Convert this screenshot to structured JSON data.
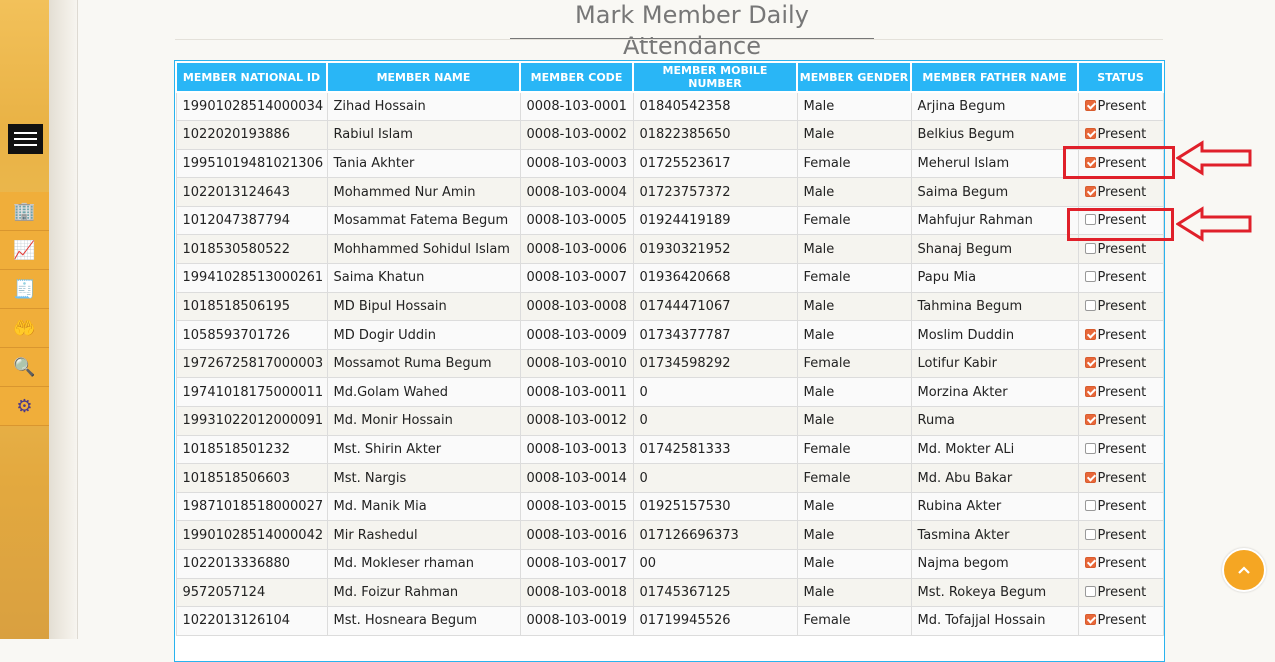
{
  "page": {
    "title": "Mark Member Daily Attendance"
  },
  "sidebar": {
    "menu_icon": "hamburger-icon",
    "items": [
      {
        "icon": "building-icon",
        "glyph": "🏢"
      },
      {
        "icon": "chart-up-icon",
        "glyph": "📈"
      },
      {
        "icon": "cash-register-icon",
        "glyph": "🧾"
      },
      {
        "icon": "hand-money-icon",
        "glyph": "🤲"
      },
      {
        "icon": "search-people-icon",
        "glyph": "🔍"
      },
      {
        "icon": "network-gear-icon",
        "glyph": "⚙"
      }
    ]
  },
  "table": {
    "columns": [
      "MEMBER NATIONAL ID",
      "MEMBER NAME",
      "MEMBER CODE",
      "MEMBER MOBILE NUMBER",
      "MEMBER GENDER",
      "MEMBER FATHER NAME",
      "STATUS"
    ],
    "status_label": "Present",
    "rows": [
      [
        "19901028514000034",
        "Zihad Hossain",
        "0008-103-0001",
        "01840542358",
        "Male",
        "Arjina Begum",
        true
      ],
      [
        "1022020193886",
        "Rabiul Islam",
        "0008-103-0002",
        "01822385650",
        "Male",
        "Belkius Begum",
        true
      ],
      [
        "19951019481021306",
        "Tania Akhter",
        "0008-103-0003",
        "01725523617",
        "Female",
        "Meherul Islam",
        true
      ],
      [
        "1022013124643",
        "Mohammed Nur Amin",
        "0008-103-0004",
        "01723757372",
        "Male",
        "Saima Begum",
        true
      ],
      [
        "1012047387794",
        "Mosammat Fatema Begum",
        "0008-103-0005",
        "01924419189",
        "Female",
        "Mahfujur Rahman",
        false
      ],
      [
        "1018530580522",
        "Mohhammed Sohidul Islam",
        "0008-103-0006",
        "01930321952",
        "Male",
        "Shanaj Begum",
        false
      ],
      [
        "19941028513000261",
        "Saima Khatun",
        "0008-103-0007",
        "01936420668",
        "Female",
        "Papu Mia",
        false
      ],
      [
        "1018518506195",
        "MD Bipul Hossain",
        "0008-103-0008",
        "01744471067",
        "Male",
        "Tahmina Begum",
        false
      ],
      [
        "1058593701726",
        "MD Dogir Uddin",
        "0008-103-0009",
        "01734377787",
        "Male",
        "Moslim Duddin",
        true
      ],
      [
        "19726725817000003",
        "Mossamot Ruma Begum",
        "0008-103-0010",
        "01734598292",
        "Female",
        "Lotifur Kabir",
        true
      ],
      [
        "19741018175000011",
        "Md.Golam Wahed",
        "0008-103-0011",
        "0",
        "Male",
        "Morzina Akter",
        true
      ],
      [
        "19931022012000091",
        "Md. Monir Hossain",
        "0008-103-0012",
        "0",
        "Male",
        "Ruma",
        true
      ],
      [
        "1018518501232",
        "Mst. Shirin Akter",
        "0008-103-0013",
        "01742581333",
        "Female",
        "Md. Mokter ALi",
        false
      ],
      [
        "1018518506603",
        "Mst. Nargis",
        "0008-103-0014",
        "0",
        "Female",
        "Md. Abu Bakar",
        true
      ],
      [
        "19871018518000027",
        "Md. Manik Mia",
        "0008-103-0015",
        "01925157530",
        "Male",
        "Rubina Akter",
        false
      ],
      [
        "19901028514000042",
        "Mir Rashedul",
        "0008-103-0016",
        "017126696373",
        "Male",
        "Tasmina Akter",
        false
      ],
      [
        "1022013336880",
        "Md. Mokleser rhaman",
        "0008-103-0017",
        "00",
        "Male",
        "Najma begom",
        true
      ],
      [
        "9572057124",
        "Md. Foizur Rahman",
        "0008-103-0018",
        "01745367125",
        "Male",
        "Mst. Rokeya Begum",
        false
      ],
      [
        "1022013126104",
        "Mst. Hosneara Begum",
        "0008-103-0019",
        "01719945526",
        "Female",
        "Md. Tofajjal Hossain",
        true
      ]
    ]
  },
  "annotations": {
    "highlight_color": "#e0202a"
  },
  "scroll_top": {
    "icon": "chevron-up-icon"
  }
}
